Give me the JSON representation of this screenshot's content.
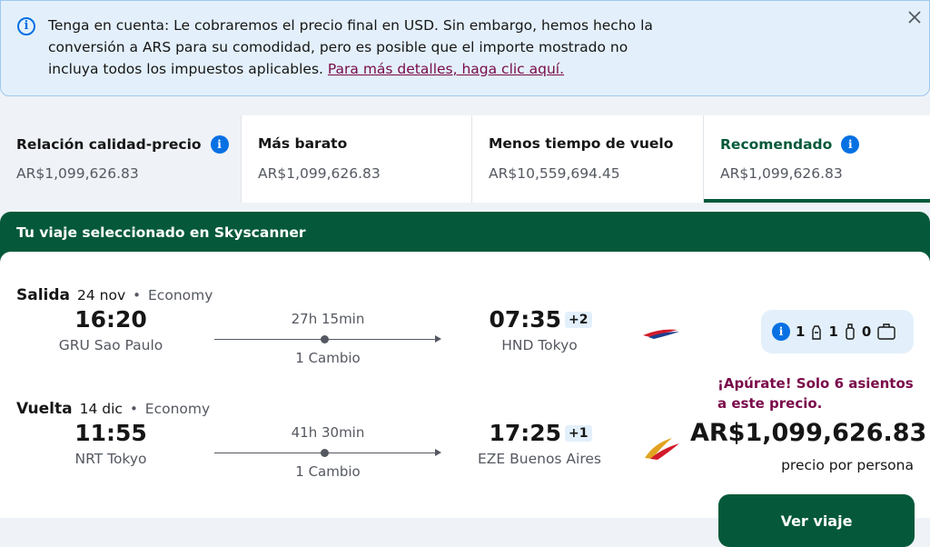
{
  "notice": {
    "text": "Tenga en cuenta: Le cobraremos el precio final en USD. Sin embargo, hemos hecho la conversión a ARS para su comodidad, pero es posible que el importe mostrado no incluya todos los impuestos aplicables. ",
    "link": "Para más detalles, haga clic aquí."
  },
  "tabs": [
    {
      "label": "Relación calidad-precio",
      "price": "AR$1,099,626.83"
    },
    {
      "label": "Más barato",
      "price": "AR$1,099,626.83"
    },
    {
      "label": "Menos tiempo de vuelo",
      "price": "AR$10,559,694.45"
    },
    {
      "label": "Recomendado",
      "price": "AR$1,099,626.83"
    }
  ],
  "card": {
    "title": "Tu viaje seleccionado en Skyscanner",
    "outbound": {
      "direction": "Salida",
      "date": "24 nov",
      "dot": "•",
      "cabin": "Economy",
      "dep_time": "16:20",
      "dep_place": "GRU Sao Paulo",
      "duration": "27h 15min",
      "stops": "1 Cambio",
      "arr_time": "07:35",
      "day_offset": "+2",
      "arr_place": "HND Tokyo"
    },
    "inbound": {
      "direction": "Vuelta",
      "date": "14 dic",
      "dot": "•",
      "cabin": "Economy",
      "dep_time": "11:55",
      "dep_place": "NRT Tokyo",
      "duration": "41h 30min",
      "stops": "1 Cambio",
      "arr_time": "17:25",
      "day_offset": "+1",
      "arr_place": "EZE Buenos Aires"
    },
    "baggage": {
      "personal": "1",
      "carry_on": "1",
      "checked": "0"
    },
    "urgency": "¡Apúrate! Solo 6 asientos a este precio.",
    "price": "AR$1,099,626.83",
    "price_note": "precio por persona",
    "cta": "Ver viaje"
  },
  "colors": {
    "accent": "#05593a",
    "info": "#0770e3",
    "urgency": "#7a0a4a"
  }
}
